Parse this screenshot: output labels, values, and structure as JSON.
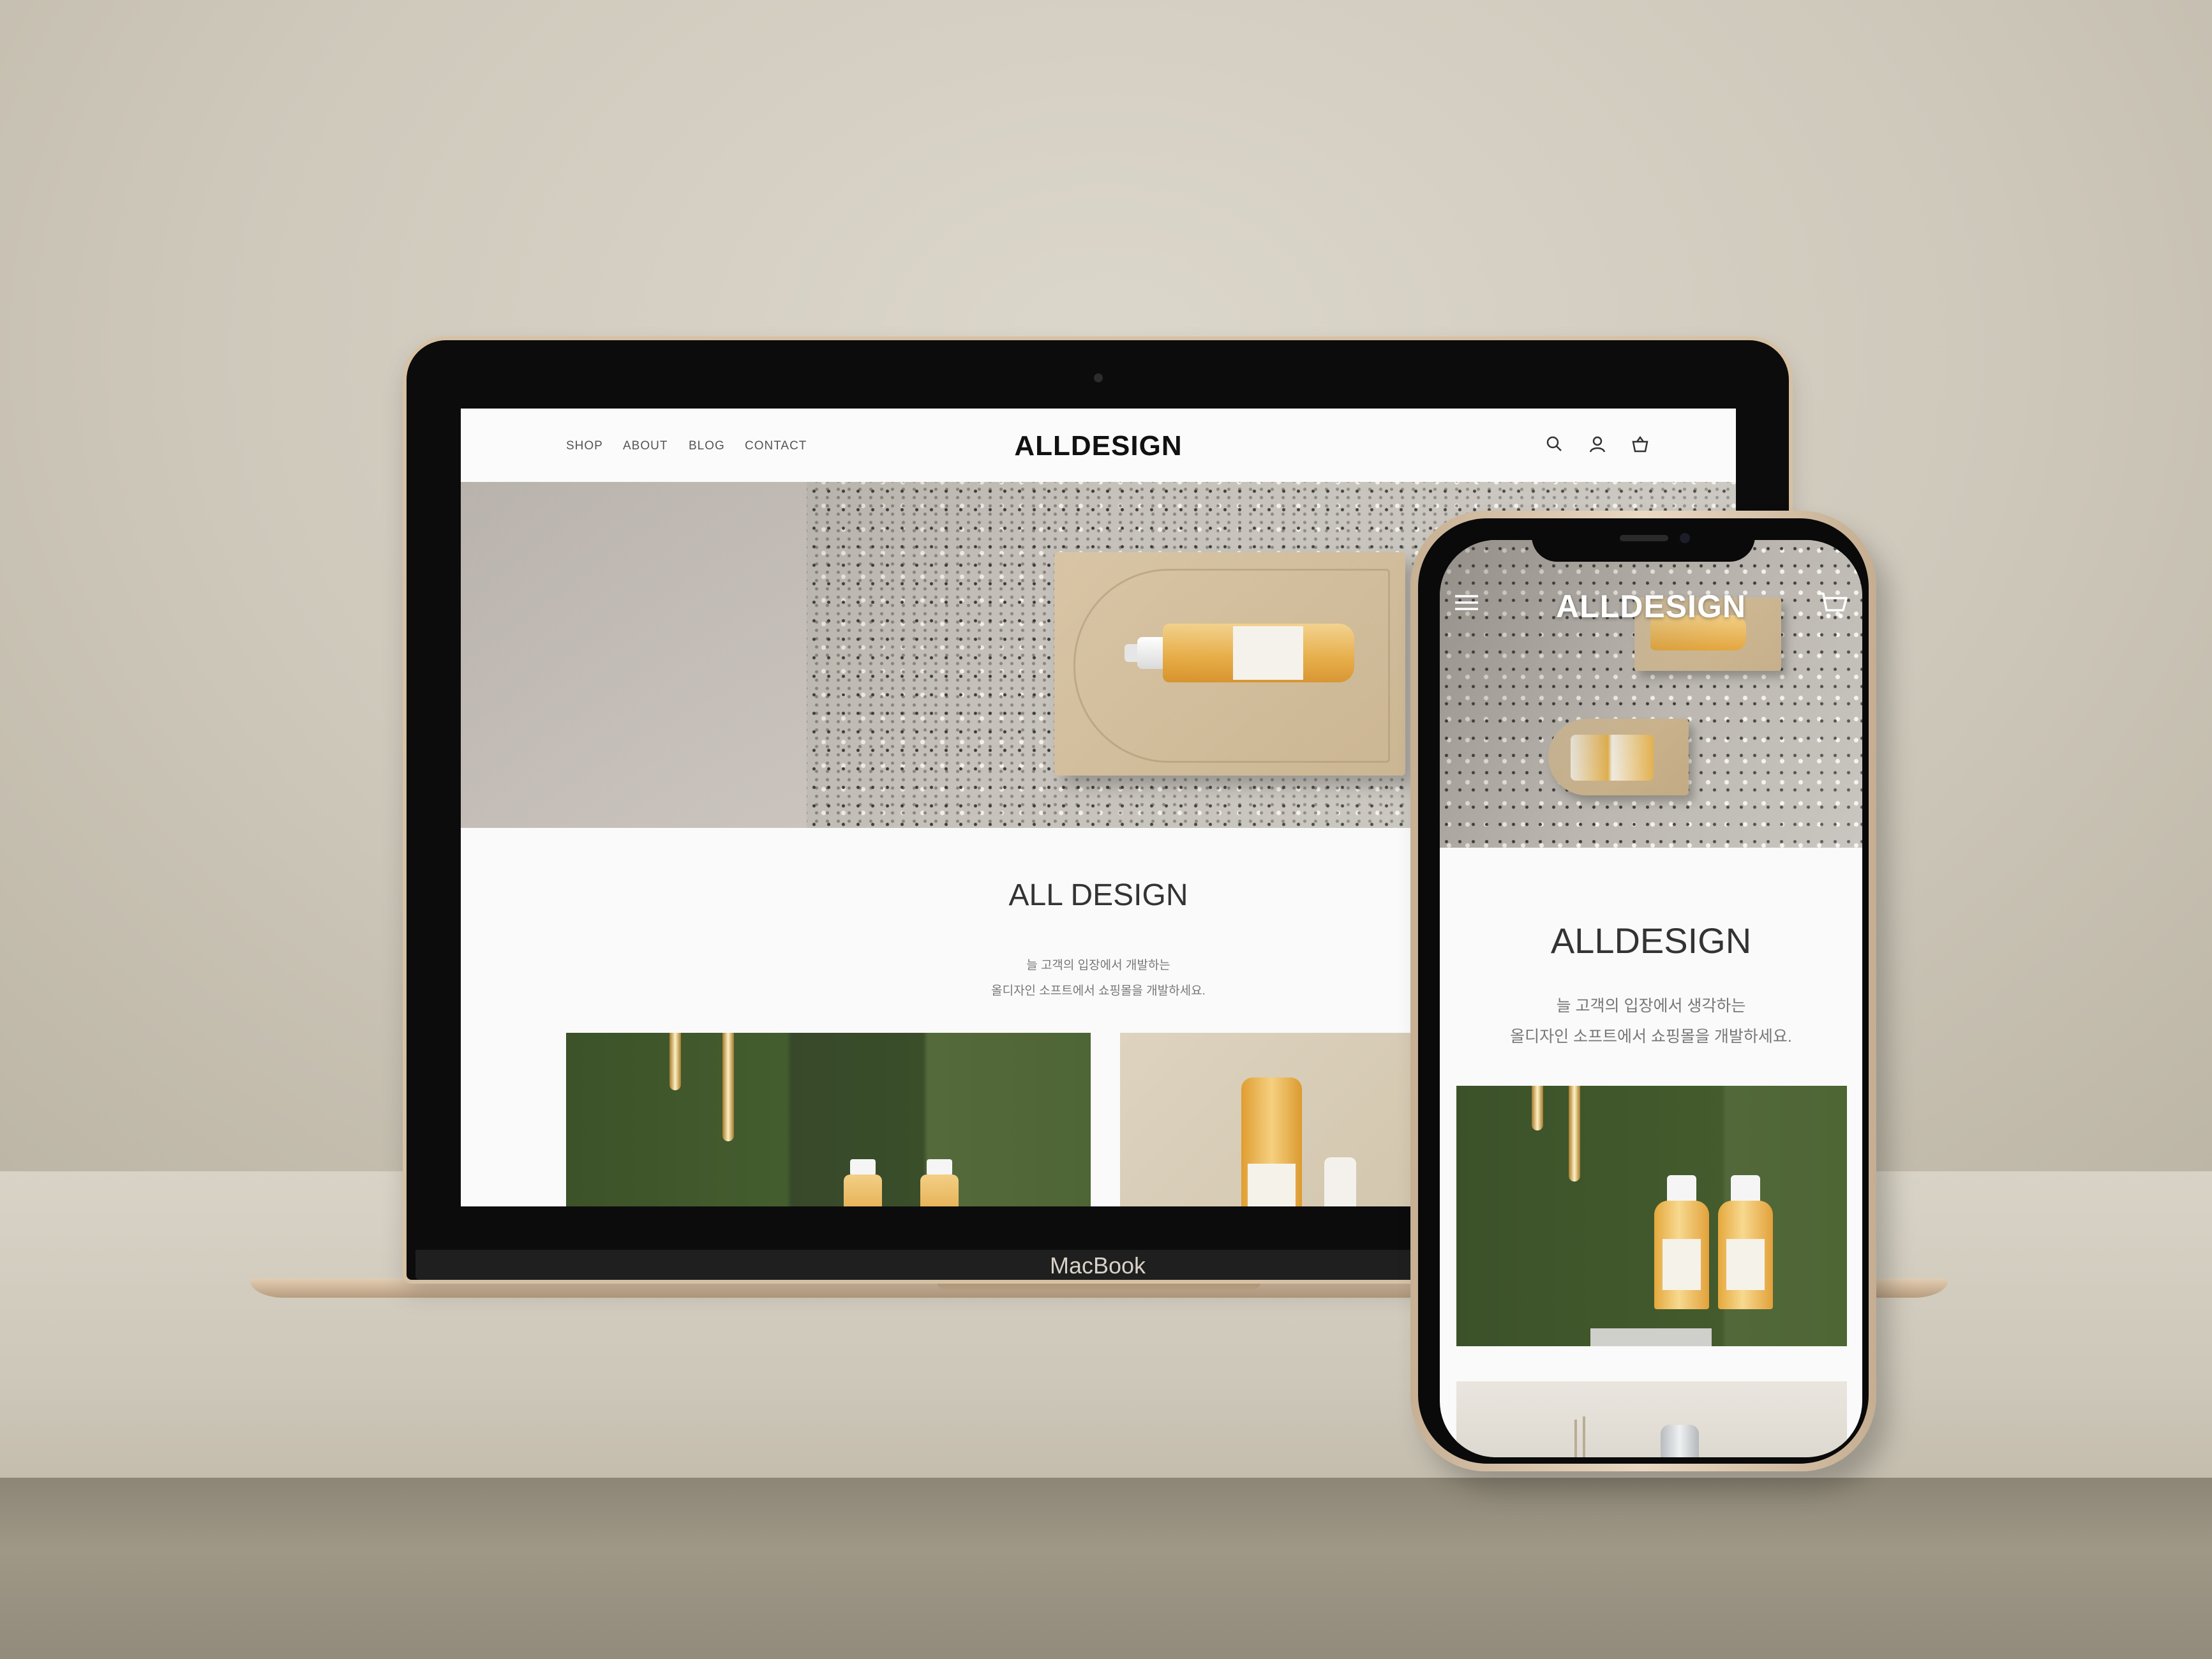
{
  "laptop": {
    "brand": "MacBook",
    "site": {
      "nav": [
        "SHOP",
        "ABOUT",
        "BLOG",
        "CONTACT"
      ],
      "logo": "ALLDESIGN",
      "icons": [
        "search-icon",
        "user-icon",
        "shopping-bag-icon"
      ],
      "section_title": "ALL DESIGN",
      "desc_line1": "늘 고객의 입장에서 개발하는",
      "desc_line2": "올디자인 소프트에서 쇼핑몰을 개발하세요."
    }
  },
  "phone": {
    "site": {
      "logo": "ALLDESIGN",
      "icons": [
        "menu-icon",
        "cart-icon"
      ],
      "section_title": "ALLDESIGN",
      "desc_line1": "늘 고객의 입장에서 생각하는",
      "desc_line2": "올디자인 소프트에서 쇼핑몰을 개발하세요."
    }
  },
  "colors": {
    "accent_green": "#445d2e",
    "product_yellow": "#e5a93f",
    "text_dark": "#111111"
  }
}
